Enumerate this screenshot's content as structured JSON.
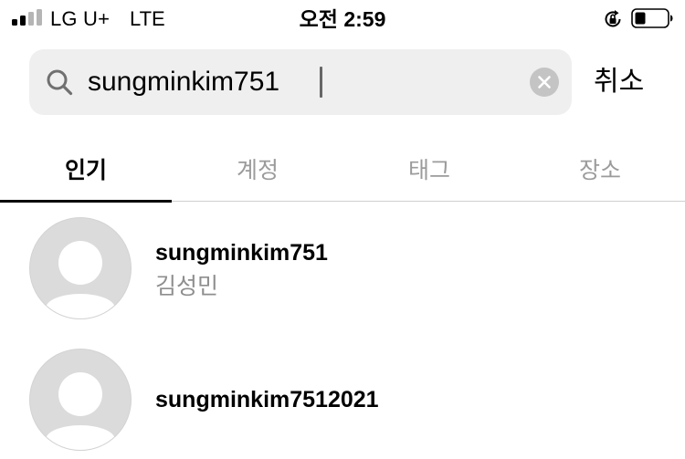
{
  "status_bar": {
    "carrier": "LG U+",
    "network": "LTE",
    "time": "오전 2:59"
  },
  "search": {
    "query": "sungminkim751",
    "cancel_label": "취소"
  },
  "tabs": [
    {
      "label": "인기",
      "active": true
    },
    {
      "label": "계정",
      "active": false
    },
    {
      "label": "태그",
      "active": false
    },
    {
      "label": "장소",
      "active": false
    }
  ],
  "results": [
    {
      "username": "sungminkim751",
      "fullname": "김성민"
    },
    {
      "username": "sungminkim7512021",
      "fullname": ""
    }
  ],
  "colors": {
    "search_bg": "#efefef",
    "inactive_tab": "#9b9b9b",
    "secondary_text": "#8e8e8e",
    "avatar_bg": "#dbdbdb"
  }
}
